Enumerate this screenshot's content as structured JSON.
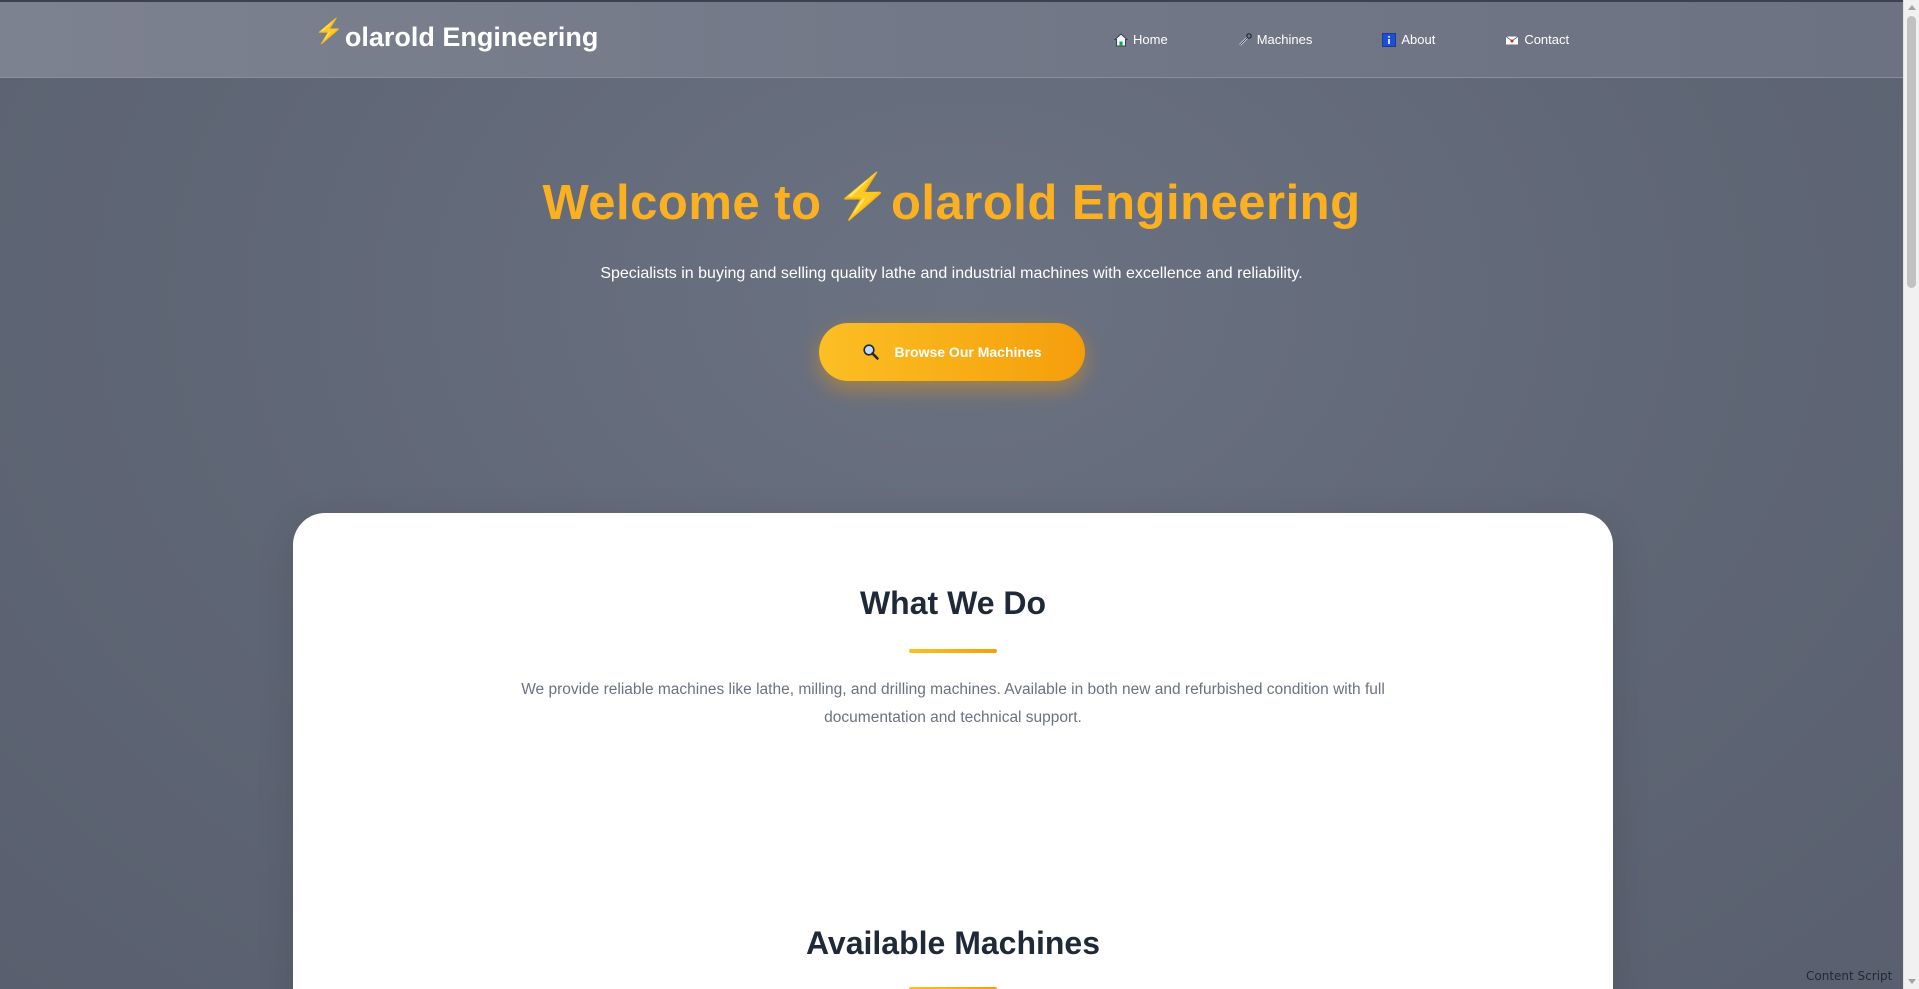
{
  "brand": {
    "bolt": "⚡",
    "name": "olarold Engineering"
  },
  "nav": {
    "items": [
      {
        "label": "Home",
        "icon": "home-icon"
      },
      {
        "label": "Machines",
        "icon": "wrench-icon"
      },
      {
        "label": "About",
        "icon": "info-icon"
      },
      {
        "label": "Contact",
        "icon": "envelope-icon"
      }
    ]
  },
  "hero": {
    "title_prefix": "Welcome to ",
    "title_bolt": "⚡",
    "title_suffix": "olarold Engineering",
    "subtitle": "Specialists in buying and selling quality lathe and industrial machines with excellence and reliability.",
    "cta_label": "Browse Our Machines",
    "cta_icon": "magnifier-icon"
  },
  "what_we_do": {
    "title": "What We Do",
    "text": "We provide reliable machines like lathe, milling, and drilling machines. Available in both new and refurbished condition with full documentation and technical support."
  },
  "available": {
    "title": "Available Machines"
  },
  "overlay": {
    "content_script": "Content Script"
  },
  "colors": {
    "accent": "#fbbf24",
    "accent_dark": "#f59e0b",
    "heading": "#1f2937",
    "body_text": "#6b7280",
    "background": "#5f6675"
  }
}
